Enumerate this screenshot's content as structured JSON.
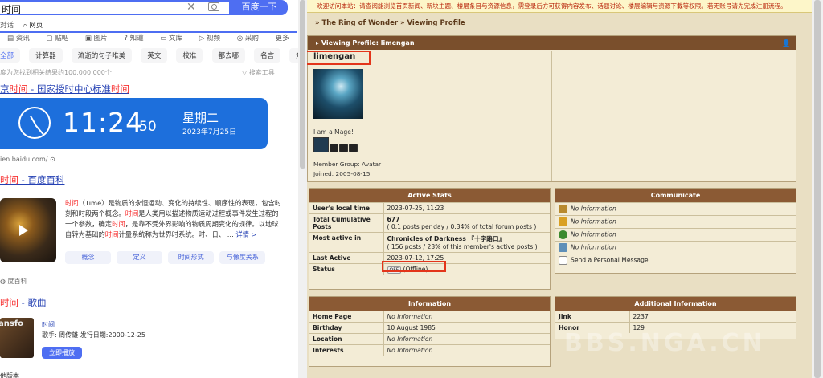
{
  "baidu": {
    "search": {
      "query": "时间",
      "button": "百度一下"
    },
    "tabs": [
      "对话",
      "网页",
      "资讯",
      "贴吧",
      "图片",
      "知道",
      "文库",
      "视频",
      "采购",
      "更多"
    ],
    "chips": [
      "全部",
      "计算器",
      "流逝的句子唯美",
      "英文",
      "校准",
      "都去哪",
      "名言",
      "短怎么"
    ],
    "result_count": "度为您找到相关结果约100,000,000个",
    "search_tools": "搜索工具",
    "result1": {
      "prefix": "京",
      "hl1": "时间",
      "mid": " - 国家授时中心标准",
      "hl2": "时间"
    },
    "clock": {
      "time": "11:24",
      "seconds": "50",
      "weekday": "星期二",
      "date": "2023年7月25日"
    },
    "clock_source": "ien.baidu.com/",
    "result2": {
      "hl": "时间",
      "rest": " - 百度百科"
    },
    "baike": {
      "text_a": "时间",
      "text_b": "（Time）是物质的永恒运动、变化的持续性、顺序性的表现，包含时刻和时段两个概念。",
      "text_c": "时间",
      "text_d": "是人类用以描述物质运动过程或事件发生过程的一个参数，确定",
      "text_e": "时间",
      "text_f": "，是靠不受外界影响的物质周期变化的规律。以地球自转为基础的",
      "text_g": "时间",
      "text_h": "计量系统称为世界时系统。时、日、 ...",
      "more": "详情 >",
      "buttons": [
        "概念",
        "定义",
        "时间形式",
        "与像度关系"
      ]
    },
    "baike_source": "度百科",
    "result3": {
      "hl": "时间",
      "rest": " - 歌曲"
    },
    "song": {
      "name": "时间",
      "meta": "歌手: 周传雄  发行日期:2000-12-25",
      "play": "立即播放",
      "thumb_text": "ansfo"
    },
    "bottom_text": "他版本"
  },
  "nga": {
    "notice": "欢迎访问本站：请查阅能浏览首页新闻、新块主题、楼层条目与资源信息，需登录后方可获得内容发布、话题讨论、楼层编辑与资源下载等权限。若无账号请先完成注册流程。",
    "breadcrumb": "» The Ring of Wonder » Viewing Profile",
    "profile_header": "Viewing Profile: limengan",
    "username": "limengan",
    "signature": "I am a Mage!",
    "member_group": "Member Group: Avatar",
    "joined": "Joined: 2005-08-15",
    "active_stats": {
      "title": "Active Stats",
      "local_time_label": "User's local time",
      "local_time": "2023-07-25, 11:23",
      "posts_label": "Total Cumulative Posts",
      "posts": "677",
      "posts_detail": "( 0.1 posts per day / 0.34% of total forum posts )",
      "most_active_label": "Most active in",
      "most_active": "Chronicles of Darkness 『十字路口』",
      "most_active_detail": "( 156 posts / 23% of this member's active posts )",
      "last_active_label": "Last Active",
      "last_active": "2023-07-12, 17:25",
      "status_label": "Status",
      "status_badge": "OFF",
      "status": "(Offline)"
    },
    "communicate": {
      "title": "Communicate",
      "rows": [
        "No Information",
        "No Information",
        "No Information",
        "No Information",
        "Send a Personal Message"
      ]
    },
    "information": {
      "title": "Information",
      "rows": [
        {
          "label": "Home Page",
          "value": "No Information"
        },
        {
          "label": "Birthday",
          "value": "10 August 1985"
        },
        {
          "label": "Location",
          "value": "No Information"
        },
        {
          "label": "Interests",
          "value": "No Information"
        }
      ]
    },
    "additional": {
      "title": "Additional Information",
      "rows": [
        {
          "label": "Jink",
          "value": "2237"
        },
        {
          "label": "Honor",
          "value": "129"
        }
      ]
    },
    "watermark": "BBS.NGA.CN"
  }
}
